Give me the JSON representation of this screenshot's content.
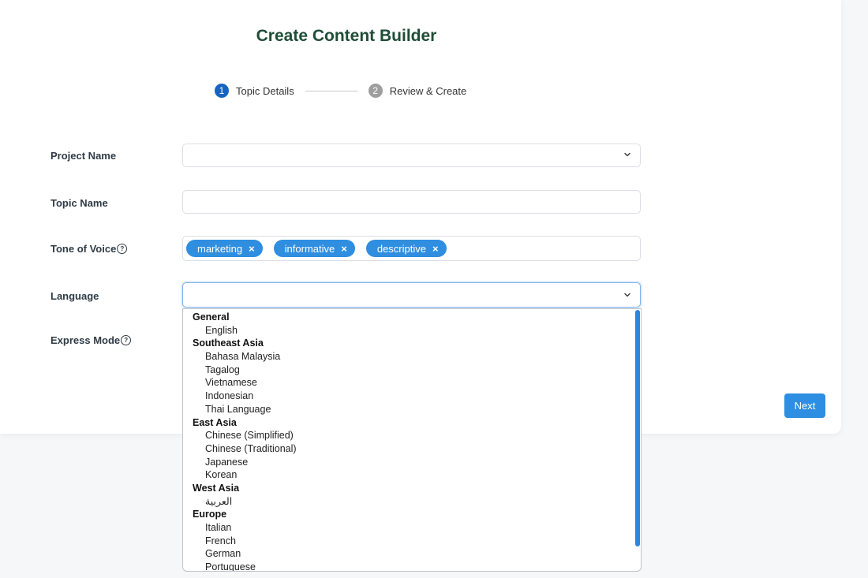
{
  "page": {
    "title": "Create Content Builder"
  },
  "stepper": {
    "steps": [
      {
        "number": "1",
        "label": "Topic Details"
      },
      {
        "number": "2",
        "label": "Review & Create"
      }
    ]
  },
  "form": {
    "project_name_label": "Project Name",
    "project_name_value": "",
    "topic_name_label": "Topic Name",
    "topic_name_value": "",
    "tone_label": "Tone of Voice",
    "tone_tags": [
      "marketing",
      "informative",
      "descriptive"
    ],
    "language_label": "Language",
    "language_value": "",
    "express_mode_label": "Express Mode",
    "help_glyph": "?",
    "tag_remove_glyph": "×"
  },
  "actions": {
    "next_label": "Next"
  },
  "language_dropdown": {
    "groups": [
      {
        "name": "General",
        "options": [
          "English"
        ]
      },
      {
        "name": "Southeast Asia",
        "options": [
          "Bahasa Malaysia",
          "Tagalog",
          "Vietnamese",
          "Indonesian",
          "Thai Language"
        ]
      },
      {
        "name": "East Asia",
        "options": [
          "Chinese (Simplified)",
          "Chinese (Traditional)",
          "Japanese",
          "Korean"
        ]
      },
      {
        "name": "West Asia",
        "options": [
          "العربية"
        ]
      },
      {
        "name": "Europe",
        "options": [
          "Italian",
          "French",
          "German",
          "Portuguese"
        ]
      }
    ]
  },
  "colors": {
    "title": "#1f4d36",
    "step_active": "#1565c0",
    "step_inactive": "#9e9e9e",
    "tag_bg": "#2f8ee0",
    "primary_button": "#2d8ee2",
    "scrollbar": "#2b86e0"
  },
  "icons": {
    "select_arrow": "chevron-down-icon",
    "help": "help-circle-icon",
    "tag_remove": "close-icon"
  }
}
